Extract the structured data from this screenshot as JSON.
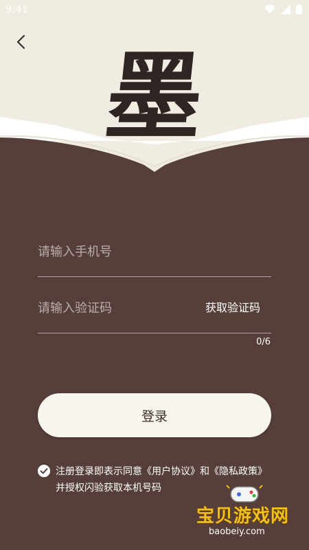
{
  "status_bar": {
    "time": "9:41"
  },
  "logo": {
    "char": "墨"
  },
  "form": {
    "phone_placeholder": "请输入手机号",
    "code_placeholder": "请输入验证码",
    "get_code_label": "获取验证码",
    "code_counter": "0/6",
    "login_label": "登录"
  },
  "agreement": {
    "prefix": "注册登录即表示同意",
    "user_agreement": "《用户协议》",
    "and": "和",
    "privacy_policy": "《隐私政策》",
    "suffix": "并授权闪验获取本机号码",
    "checked": true
  },
  "watermark": {
    "name": "宝贝游戏网",
    "url": "baobeiy.com"
  },
  "colors": {
    "background": "#563f3b",
    "header_bg": "#f1ece1",
    "button_bg": "#f8f5ee",
    "watermark": "#f0c021"
  }
}
